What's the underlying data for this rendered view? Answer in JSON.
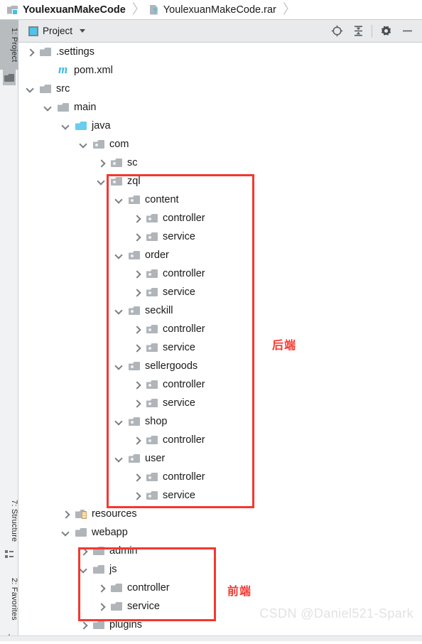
{
  "breadcrumb": {
    "items": [
      {
        "label": "YoulexuanMakeCode",
        "icon": "module-icon"
      },
      {
        "label": "YoulexuanMakeCode.rar",
        "icon": "unknown-file-icon"
      }
    ],
    "separator": "〉"
  },
  "toolstrip": {
    "project_tab": "1: Project",
    "structure_tab": "7: Structure",
    "favorites_tab": "2: Favorites",
    "favorites_glyph": "★"
  },
  "panel": {
    "title": "Project",
    "dropdown_caret": "▾",
    "tools": [
      {
        "name": "locate-icon",
        "title": "Select Opened File"
      },
      {
        "name": "collapse-all-icon",
        "title": "Collapse All"
      },
      {
        "name": "settings-gear-icon",
        "title": "Settings"
      },
      {
        "name": "hide-icon",
        "title": "Hide"
      }
    ]
  },
  "tree": {
    "rows": [
      {
        "label": ".settings",
        "indent": 1,
        "arrow": "closed",
        "icon": "folder"
      },
      {
        "label": "pom.xml",
        "indent": 2,
        "arrow": "none",
        "icon": "maven"
      },
      {
        "label": "src",
        "indent": 1,
        "arrow": "open",
        "icon": "folder"
      },
      {
        "label": "main",
        "indent": 2,
        "arrow": "open",
        "icon": "folder"
      },
      {
        "label": "java",
        "indent": 3,
        "arrow": "open",
        "icon": "folderblue"
      },
      {
        "label": "com",
        "indent": 4,
        "arrow": "open",
        "icon": "package"
      },
      {
        "label": "sc",
        "indent": 5,
        "arrow": "closed",
        "icon": "package"
      },
      {
        "label": "zql",
        "indent": 5,
        "arrow": "open",
        "icon": "package"
      },
      {
        "label": "content",
        "indent": 6,
        "arrow": "open",
        "icon": "package"
      },
      {
        "label": "controller",
        "indent": 7,
        "arrow": "closed",
        "icon": "package"
      },
      {
        "label": "service",
        "indent": 7,
        "arrow": "closed",
        "icon": "package"
      },
      {
        "label": "order",
        "indent": 6,
        "arrow": "open",
        "icon": "package"
      },
      {
        "label": "controller",
        "indent": 7,
        "arrow": "closed",
        "icon": "package"
      },
      {
        "label": "service",
        "indent": 7,
        "arrow": "closed",
        "icon": "package"
      },
      {
        "label": "seckill",
        "indent": 6,
        "arrow": "open",
        "icon": "package"
      },
      {
        "label": "controller",
        "indent": 7,
        "arrow": "closed",
        "icon": "package"
      },
      {
        "label": "service",
        "indent": 7,
        "arrow": "closed",
        "icon": "package"
      },
      {
        "label": "sellergoods",
        "indent": 6,
        "arrow": "open",
        "icon": "package"
      },
      {
        "label": "controller",
        "indent": 7,
        "arrow": "closed",
        "icon": "package"
      },
      {
        "label": "service",
        "indent": 7,
        "arrow": "closed",
        "icon": "package"
      },
      {
        "label": "shop",
        "indent": 6,
        "arrow": "open",
        "icon": "package"
      },
      {
        "label": "controller",
        "indent": 7,
        "arrow": "closed",
        "icon": "package"
      },
      {
        "label": "user",
        "indent": 6,
        "arrow": "open",
        "icon": "package"
      },
      {
        "label": "controller",
        "indent": 7,
        "arrow": "closed",
        "icon": "package"
      },
      {
        "label": "service",
        "indent": 7,
        "arrow": "closed",
        "icon": "package"
      },
      {
        "label": "resources",
        "indent": 3,
        "arrow": "closed",
        "icon": "resources"
      },
      {
        "label": "webapp",
        "indent": 3,
        "arrow": "open",
        "icon": "folder"
      },
      {
        "label": "admin",
        "indent": 4,
        "arrow": "closed",
        "icon": "folder"
      },
      {
        "label": "js",
        "indent": 4,
        "arrow": "open",
        "icon": "folder"
      },
      {
        "label": "controller",
        "indent": 5,
        "arrow": "closed",
        "icon": "folder"
      },
      {
        "label": "service",
        "indent": 5,
        "arrow": "closed",
        "icon": "folder"
      },
      {
        "label": "plugins",
        "indent": 4,
        "arrow": "closed",
        "icon": "folder"
      }
    ]
  },
  "annotations": {
    "color": "#f5372f",
    "backend_label": "后端",
    "frontend_label": "前端"
  },
  "watermark": "CSDN @Daniel521-Spark"
}
